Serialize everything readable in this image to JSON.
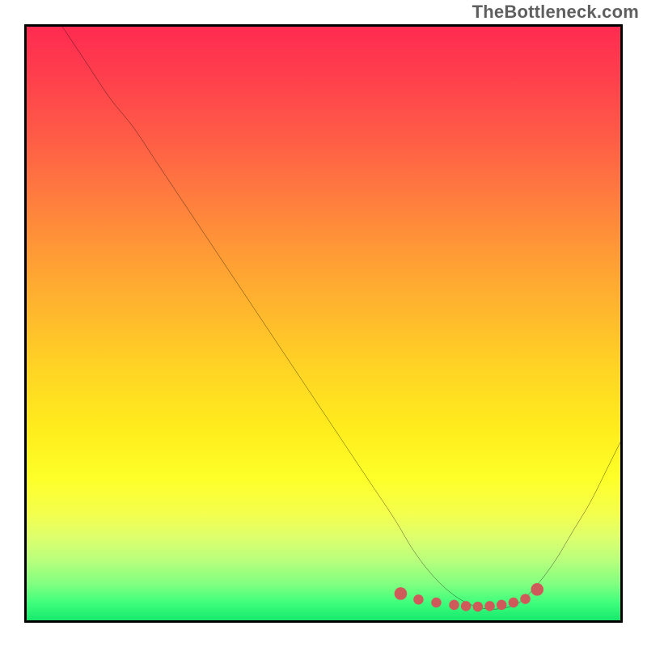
{
  "watermark": "TheBottleneck.com",
  "chart_data": {
    "type": "line",
    "title": "",
    "xlabel": "",
    "ylabel": "",
    "xlim": [
      0,
      100
    ],
    "ylim": [
      0,
      100
    ],
    "grid": false,
    "series": [
      {
        "name": "bottleneck-curve",
        "x": [
          6,
          10,
          14,
          18,
          22,
          26,
          30,
          34,
          38,
          42,
          46,
          50,
          54,
          58,
          62,
          65,
          68,
          71,
          74,
          77,
          80,
          83,
          86,
          89,
          92,
          95,
          98,
          100
        ],
        "y": [
          100,
          94,
          88,
          83,
          77,
          71,
          65,
          59,
          53,
          47,
          41,
          35,
          29,
          23,
          17,
          12,
          8,
          5,
          3,
          2,
          2,
          3,
          6,
          10,
          15,
          20,
          26,
          30
        ]
      }
    ],
    "markers": {
      "name": "min-region-dots",
      "x": [
        63,
        66,
        69,
        72,
        74,
        76,
        78,
        80,
        82,
        84,
        86
      ],
      "y": [
        4.5,
        3.5,
        3.0,
        2.6,
        2.4,
        2.3,
        2.4,
        2.6,
        3.0,
        3.6,
        5.2
      ],
      "color": "#cf5a5a",
      "size": 6
    },
    "background_gradient": {
      "stops": [
        {
          "pos": 0.0,
          "color": "#ff2b50"
        },
        {
          "pos": 0.5,
          "color": "#ffd524"
        },
        {
          "pos": 0.8,
          "color": "#feff28"
        },
        {
          "pos": 1.0,
          "color": "#17e86d"
        }
      ]
    }
  }
}
